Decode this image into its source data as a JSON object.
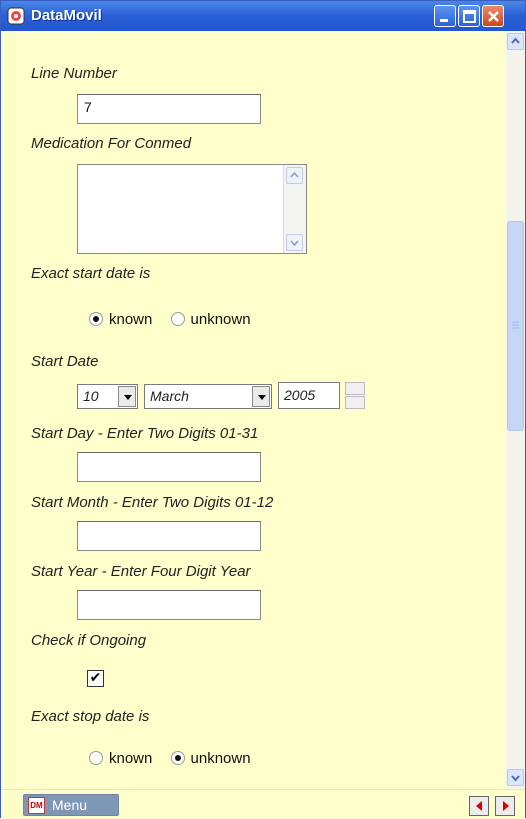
{
  "window": {
    "title": "DataMovil"
  },
  "form": {
    "line_number_label": "Line Number",
    "line_number_value": "7",
    "medication_label": "Medication For Conmed",
    "medication_value": "",
    "exact_start_label": "Exact start date is",
    "start_known_label": "known",
    "start_unknown_label": "unknown",
    "start_selected": "known",
    "start_date_label": "Start Date",
    "start_day_select": "10",
    "start_month_select": "March",
    "start_year_select": "2005",
    "start_day_label": "Start Day - Enter Two Digits 01-31",
    "start_day_value": "",
    "start_month_label": "Start Month - Enter Two Digits 01-12",
    "start_month_value": "",
    "start_year_label": "Start Year - Enter Four Digit Year",
    "start_year_value": "",
    "ongoing_label": "Check if Ongoing",
    "ongoing_checked": "✔",
    "exact_stop_label": "Exact stop date is",
    "stop_known_label": "known",
    "stop_unknown_label": "unknown",
    "stop_selected": "unknown"
  },
  "bottom": {
    "menu_label": "Menu",
    "menu_icon_text": "DM"
  },
  "colors": {
    "background": "#ffffcc",
    "titlebar": "#2a5fd6",
    "menu_button": "#7f97b6"
  }
}
